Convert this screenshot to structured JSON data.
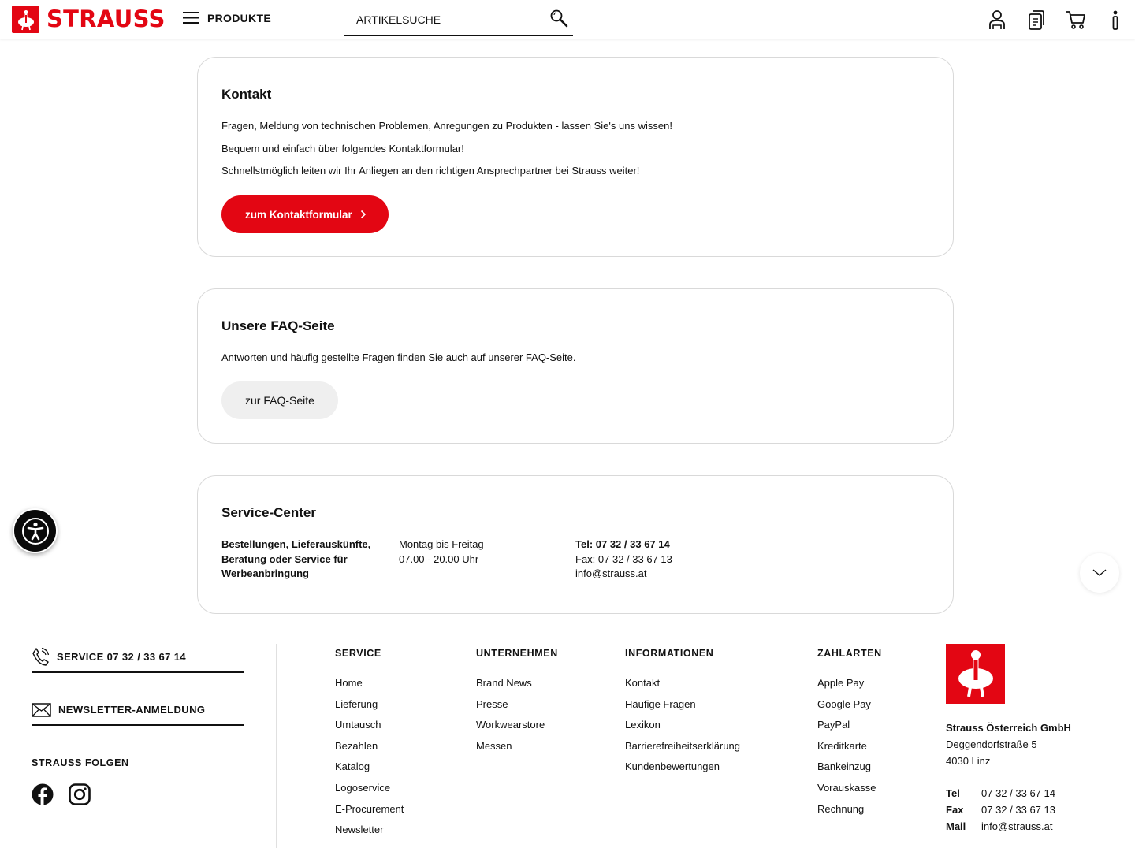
{
  "header": {
    "brand": "STRAUSS",
    "menu_label": "PRODUKTE",
    "search_placeholder": "ARTIKELSUCHE",
    "icons": [
      "user-icon",
      "clipboard-icon",
      "cart-icon",
      "info-icon"
    ]
  },
  "kontakt": {
    "title": "Kontakt",
    "line1": "Fragen, Meldung von technischen Problemen, Anregungen zu Produkten - lassen Sie's uns wissen!",
    "line2": "Bequem und einfach über folgendes Kontaktformular!",
    "line3": "Schnellstmöglich leiten wir Ihr Anliegen an den richtigen Ansprechpartner bei Strauss weiter!",
    "button": "zum Kontaktformular"
  },
  "faq": {
    "title": "Unsere FAQ-Seite",
    "text": "Antworten und häufig gestellte Fragen finden Sie auch auf unserer FAQ-Seite.",
    "button": "zur FAQ-Seite"
  },
  "service_center": {
    "title": "Service-Center",
    "topic_l1": "Bestellungen, Lieferauskünfte,",
    "topic_l2": "Beratung oder Service für",
    "topic_l3": "Werbeanbringung",
    "days": "Montag bis Freitag",
    "hours": "07.00 - 20.00 Uhr",
    "tel": "Tel: 07 32 / 33 67 14",
    "fax": "Fax: 07 32 / 33 67 13",
    "mail": "info@strauss.at"
  },
  "footer": {
    "service_phone": "SERVICE 07 32 / 33 67 14",
    "newsletter": "NEWSLETTER-ANMELDUNG",
    "follow": "STRAUSS FOLGEN",
    "columns": {
      "service": {
        "title": "SERVICE",
        "items": [
          "Home",
          "Lieferung",
          "Umtausch",
          "Bezahlen",
          "Katalog",
          "Logoservice",
          "E-Procurement",
          "Newsletter"
        ]
      },
      "unternehmen": {
        "title": "UNTERNEHMEN",
        "items": [
          "Brand News",
          "Presse",
          "Workwearstore",
          "Messen"
        ]
      },
      "informationen": {
        "title": "INFORMATIONEN",
        "items": [
          "Kontakt",
          "Häufige Fragen",
          "Lexikon",
          "Barrierefreiheitserklärung",
          "Kundenbewertungen"
        ]
      },
      "zahlarten": {
        "title": "ZAHLARTEN",
        "items": [
          "Apple Pay",
          "Google Pay",
          "PayPal",
          "Kreditkarte",
          "Bankeinzug",
          "Vorauskasse",
          "Rechnung"
        ]
      }
    },
    "company": {
      "name": "Strauss Österreich GmbH",
      "street": "Deggendorfstraße 5",
      "city": "4030 Linz",
      "tel_label": "Tel",
      "tel": "07 32 / 33 67 14",
      "fax_label": "Fax",
      "fax": "07 32 / 33 67 13",
      "mail_label": "Mail",
      "mail": "info@strauss.at"
    }
  },
  "colors": {
    "brand_red": "#e30613",
    "text": "#111111",
    "border": "#d9d9d9"
  }
}
